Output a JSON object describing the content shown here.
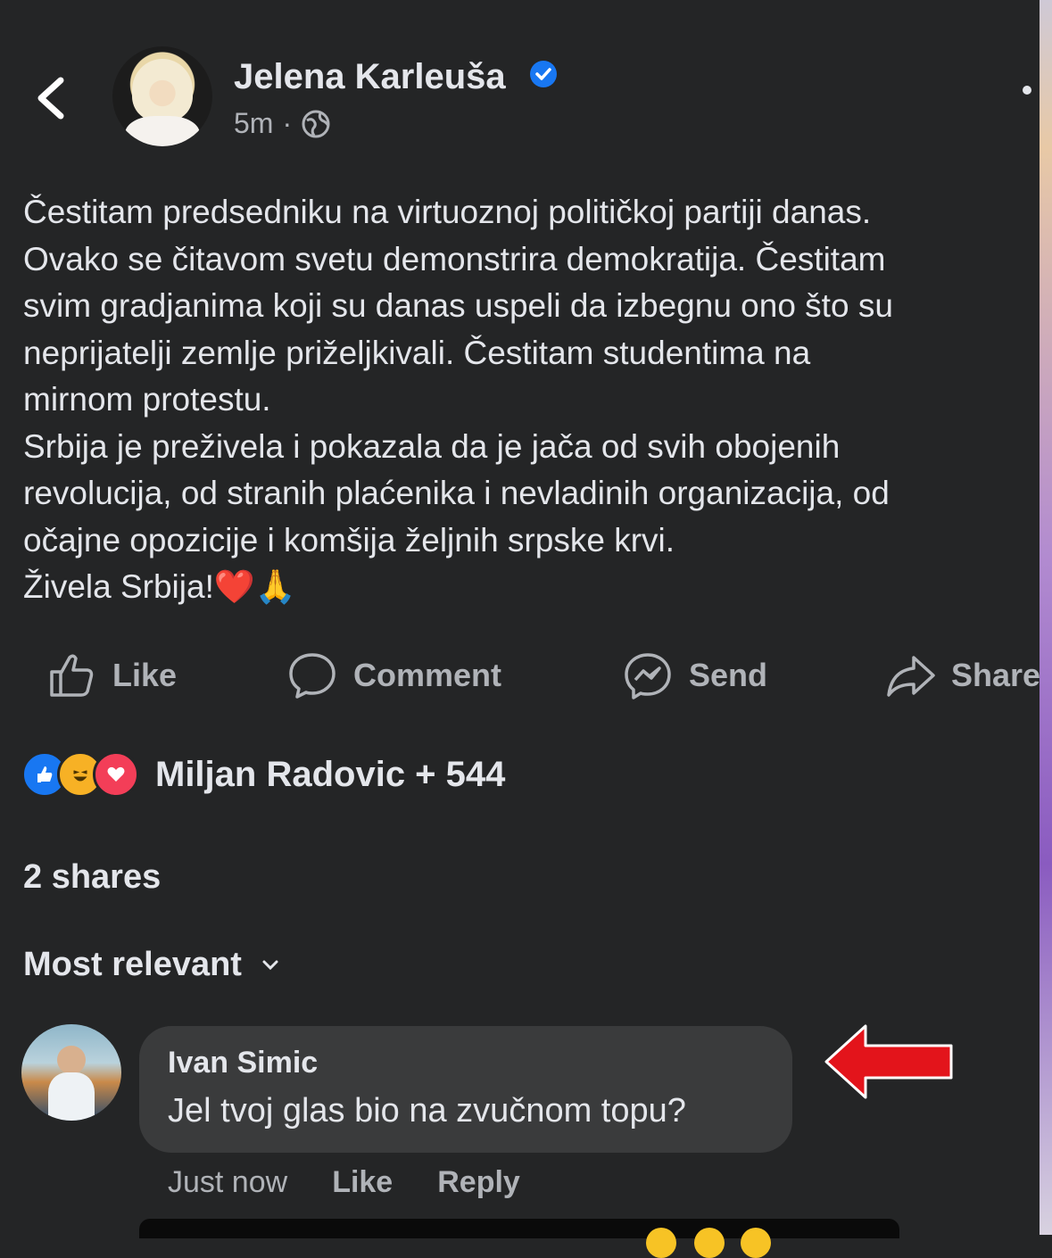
{
  "header": {
    "author": "Jelena Karleuša",
    "time": "5m",
    "separator": "·"
  },
  "post": {
    "lines": [
      "Čestitam predsedniku na virtuoznoj političkoj partiji danas.",
      "Ovako se čitavom svetu demonstrira demokratija. Čestitam",
      "svim gradjanima koji su danas uspeli da izbegnu ono što su",
      "neprijatelji zemlje priželjkivali. Čestitam studentima na",
      "mirnom protestu.",
      "Srbija je preživela i pokazala da je jača od svih obojenih",
      "revolucija, od stranih plaćenika i nevladinih organizacija, od",
      "očajne opozicije i komšija željnih srpske krvi.",
      "Živela Srbija!"
    ],
    "emoji": "❤️🙏"
  },
  "actions": {
    "like": "Like",
    "comment": "Comment",
    "send": "Send",
    "share": "Share"
  },
  "reactions": {
    "summary": "Miljan Radovic + 544"
  },
  "shares": "2 shares",
  "sort_label": "Most relevant",
  "comment": {
    "author": "Ivan Simic",
    "text": "Jel tvoj glas bio na zvučnom topu?",
    "time": "Just now",
    "like": "Like",
    "reply": "Reply"
  },
  "colors": {
    "background": "#242526",
    "bubble": "#3a3b3c",
    "text": "#e4e6eb",
    "muted": "#b0b3b8",
    "verified": "#1877f2",
    "annotation_arrow": "#e3141b"
  }
}
